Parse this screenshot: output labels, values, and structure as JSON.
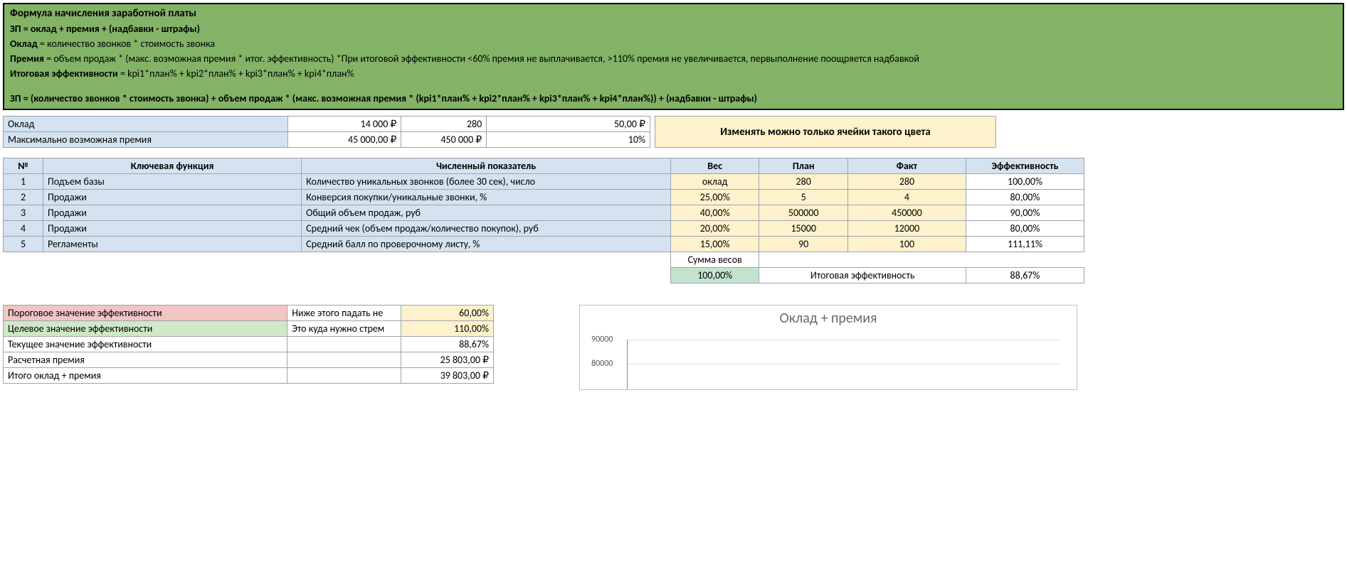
{
  "formula": {
    "title": "Формула начисления заработной платы",
    "line1_bold": "ЗП = оклад + премия + (надбавки - штрафы)",
    "line2_b": "Оклад",
    "line2_rest": " = количество звонков * стоимость звонка",
    "line3_b": "Премия",
    "line3_rest": " = объем продаж * (макс. возможная премия * итог. эффективность)    *При итоговой эффективности <60% премия не выплачивается, >110% премия не увеличивается, первыполнение поощряется надбавкой",
    "line4_b": "Итоговая эффективности",
    "line4_rest": " = kpi1*план% + kpi2*план% + kpi3*план% + kpi4*план%",
    "line5_bold": "ЗП = (количество звонков * стоимость звонка) + объем продаж * (макс. возможная премия * (kpi1*план% + kpi2*план% + kpi3*план% + kpi4*план%)) + (надбавки - штрафы)"
  },
  "params": {
    "rows": [
      {
        "label": "Оклад",
        "v1": "14 000 ₽",
        "v2": "280",
        "v3": "50,00 ₽"
      },
      {
        "label": "Максимально возможная премия",
        "v1": "45 000,00 ₽",
        "v2": "450 000 ₽",
        "v3": "10%"
      }
    ],
    "notice": "Изменять можно только ячейки такого цвета"
  },
  "kpi": {
    "headers": {
      "num": "№",
      "func": "Ключевая функция",
      "metric": "Численный показатель",
      "weight": "Вес",
      "plan": "План",
      "fact": "Факт",
      "eff": "Эффективность"
    },
    "rows": [
      {
        "n": "1",
        "func": "Подъем базы",
        "metric": "Количество уникальных звонков (более 30 сек), число",
        "weight": "оклад",
        "plan": "280",
        "fact": "280",
        "eff": "100,00%"
      },
      {
        "n": "2",
        "func": "Продажи",
        "metric": "Конверсия покупки/уникальные звонки, %",
        "weight": "25,00%",
        "plan": "5",
        "fact": "4",
        "eff": "80,00%"
      },
      {
        "n": "3",
        "func": "Продажи",
        "metric": "Общий объем продаж, руб",
        "weight": "40,00%",
        "plan": "500000",
        "fact": "450000",
        "eff": "90,00%"
      },
      {
        "n": "4",
        "func": "Продажи",
        "metric": "Средний чек (объем продаж/количество покупок), руб",
        "weight": "20,00%",
        "plan": "15000",
        "fact": "12000",
        "eff": "80,00%"
      },
      {
        "n": "5",
        "func": "Регламенты",
        "metric": "Средний балл по проверочному листу, %",
        "weight": "15,00%",
        "plan": "90",
        "fact": "100",
        "eff": "111,11%"
      }
    ],
    "sum_label": "Сумма весов",
    "sum_value": "100,00%",
    "total_eff_label": "Итоговая эффективность",
    "total_eff_value": "88,67%"
  },
  "eff": {
    "rows": [
      {
        "label": "Пороговое значение эффективности",
        "desc": "Ниже этого падать не",
        "val": "60,00%",
        "label_bg": "pink",
        "val_bg": "cream"
      },
      {
        "label": "Целевое значение эффективности",
        "desc": "Это куда нужно стрем",
        "val": "110,00%",
        "label_bg": "lgreen",
        "val_bg": "cream"
      },
      {
        "label": "Текущее значение эффективности",
        "desc": "",
        "val": "88,67%",
        "label_bg": "",
        "val_bg": ""
      },
      {
        "label": "Расчетная премия",
        "desc": "",
        "val": "25 803,00 ₽",
        "label_bg": "",
        "val_bg": ""
      },
      {
        "label": "Итого оклад + премия",
        "desc": "",
        "val": "39 803,00 ₽",
        "label_bg": "",
        "val_bg": ""
      }
    ]
  },
  "chart_data": {
    "type": "bar",
    "title": "Оклад + премия",
    "ylabel": "",
    "xlabel": "",
    "ylim": [
      0,
      90000
    ],
    "ticks_visible": [
      90000,
      80000
    ],
    "categories": [],
    "values": []
  }
}
